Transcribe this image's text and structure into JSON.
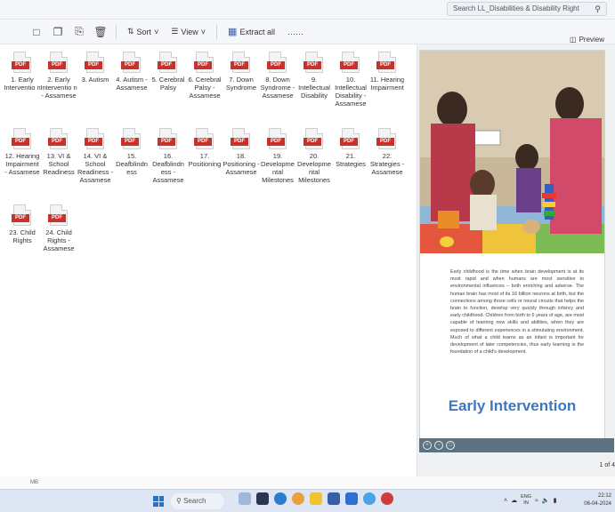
{
  "search": {
    "text": "Search LL_Disabilities & Disability Right",
    "icon": "search-icon"
  },
  "toolbar": {
    "sort_label": "Sort",
    "view_label": "View",
    "extract_label": "Extract all",
    "more_label": "……"
  },
  "preview_label": "Preview",
  "files": [
    {
      "name": "1. Early Interventio n"
    },
    {
      "name": "2. Early Interventio n - Assamese"
    },
    {
      "name": "3. Autism"
    },
    {
      "name": "4. Autism - Assamese"
    },
    {
      "name": "5. Cerebral Palsy"
    },
    {
      "name": "6. Cerebral Palsy - Assamese"
    },
    {
      "name": "7. Down Syndrome"
    },
    {
      "name": "8. Down Syndrome - Assamese"
    },
    {
      "name": "9. Intellectual Disability"
    },
    {
      "name": "10. Intellectual Disability - Assamese"
    },
    {
      "name": "11. Hearing Impairment"
    },
    {
      "name": "12. Hearing Impairment - Assamese"
    },
    {
      "name": "13. VI & School Readiness"
    },
    {
      "name": "14. VI & School Readiness - Assamese"
    },
    {
      "name": "15. Deafblindn ess"
    },
    {
      "name": "16. Deafblindn ess - Assamese"
    },
    {
      "name": "17. Positioning"
    },
    {
      "name": "18. Positioning - Assamese"
    },
    {
      "name": "19. Developme ntal Milestones"
    },
    {
      "name": "20. Developme ntal Milestones"
    },
    {
      "name": "21. Strategies"
    },
    {
      "name": "22. Strategies - Assamese"
    },
    {
      "name": "23. Child Rights"
    },
    {
      "name": "24. Child Rights - Assamese"
    }
  ],
  "file_tag": "PDF",
  "preview": {
    "body_text": "Early childhood is the time when brain development is at its most rapid and when humans are most sensitive to environmental influences – both enriching and adverse. The human brain has most of its 16 billion neurons at birth, but the connections among those cells or neural circuits that helps the brain to function, develop very quickly through infancy and early childhood. Children from birth to 6 years of age, are most capable of learning new skills and abilities, when they are exposed to different experiences in a stimulating environment. Much of what a child learns as an infant is important for development of later competencies, thus early learning is the foundation of a child's development.",
    "title": "Early Intervention",
    "page_count": "1 of 4"
  },
  "status_text": "MB",
  "taskbar": {
    "search_label": "Search",
    "lang": "ENG",
    "lang2": "IN",
    "time": "22:12",
    "date": "06-04-2024"
  },
  "colors": {
    "pdf_red": "#c8322b",
    "title_blue": "#3a78c2",
    "start_blue": "#1d73d8"
  }
}
